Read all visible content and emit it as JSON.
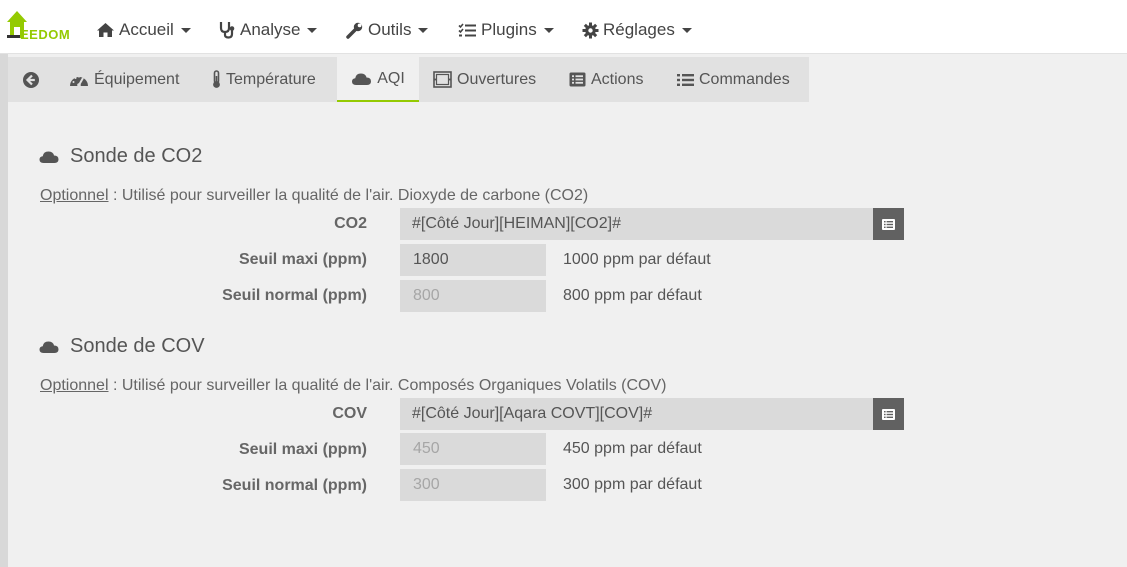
{
  "brand": {
    "logo_text": "EEDOM"
  },
  "nav": {
    "accueil": "Accueil",
    "analyse": "Analyse",
    "outils": "Outils",
    "plugins": "Plugins",
    "reglages": "Réglages"
  },
  "tabs": {
    "equipement": "Équipement",
    "temperature": "Température",
    "aqi": "AQI",
    "ouvertures": "Ouvertures",
    "actions": "Actions",
    "commandes": "Commandes"
  },
  "co2": {
    "title": "Sonde de CO2",
    "help_optional": "Optionnel",
    "help_text": " : Utilisé pour surveiller la qualité de l'air. Dioxyde de carbone (CO2)",
    "cmd_label": "CO2",
    "cmd_value": "#[Côté Jour][HEIMAN][CO2]#",
    "max_label": "Seuil maxi (ppm)",
    "max_value": "1800",
    "max_hint": "1000 ppm par défaut",
    "normal_label": "Seuil normal (ppm)",
    "normal_placeholder": "800",
    "normal_hint": "800 ppm par défaut"
  },
  "cov": {
    "title": "Sonde de COV",
    "help_optional": "Optionnel",
    "help_text": " : Utilisé pour surveiller la qualité de l'air. Composés Organiques Volatils (COV)",
    "cmd_label": "COV",
    "cmd_value": "#[Côté Jour][Aqara COVT][COV]#",
    "max_label": "Seuil maxi (ppm)",
    "max_placeholder": "450",
    "max_hint": "450 ppm par défaut",
    "normal_label": "Seuil normal (ppm)",
    "normal_placeholder": "300",
    "normal_hint": "300 ppm par défaut"
  },
  "colors": {
    "accent": "#94ca02",
    "tabbar": "#e1e1e1",
    "field": "#dadada",
    "list_button": "#616161"
  },
  "icons": {
    "logo": "house-icon",
    "accueil": "home-icon",
    "analyse": "stethoscope-icon",
    "outils": "wrench-icon",
    "plugins": "tasks-icon",
    "reglages": "cogs-icon",
    "back": "arrow-circle-left-icon",
    "equipement": "tachometer-icon",
    "temperature": "thermometer-icon",
    "aqi": "cloud-icon",
    "ouvertures": "window-icon",
    "actions": "list-alt-icon",
    "commandes": "list-icon",
    "select_cmd": "list-alt-icon"
  }
}
